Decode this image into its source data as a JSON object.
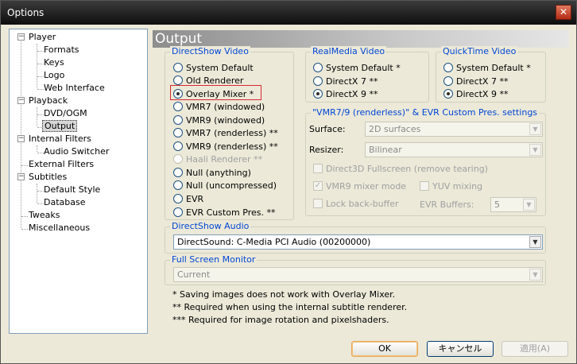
{
  "window": {
    "title": "Options",
    "close_glyph": "✕"
  },
  "tree": {
    "items": [
      {
        "label": "Player"
      },
      {
        "label": "Formats"
      },
      {
        "label": "Keys"
      },
      {
        "label": "Logo"
      },
      {
        "label": "Web Interface"
      },
      {
        "label": "Playback"
      },
      {
        "label": "DVD/OGM"
      },
      {
        "label": "Output"
      },
      {
        "label": "Internal Filters"
      },
      {
        "label": "Audio Switcher"
      },
      {
        "label": "External Filters"
      },
      {
        "label": "Subtitles"
      },
      {
        "label": "Default Style"
      },
      {
        "label": "Database"
      },
      {
        "label": "Tweaks"
      },
      {
        "label": "Miscellaneous"
      }
    ],
    "expander": "−"
  },
  "page": {
    "title": "Output"
  },
  "directshow_video": {
    "label": "DirectShow Video",
    "options": [
      "System Default",
      "Old Renderer",
      "Overlay Mixer *",
      "VMR7 (windowed)",
      "VMR9 (windowed)",
      "VMR7 (renderless) **",
      "VMR9 (renderless) **",
      "Haali Renderer **",
      "Null (anything)",
      "Null (uncompressed)",
      "EVR",
      "EVR Custom Pres. **"
    ],
    "selected": "Overlay Mixer *"
  },
  "realmedia_video": {
    "label": "RealMedia Video",
    "options": [
      "System Default *",
      "DirectX 7 **",
      "DirectX 9 **"
    ],
    "selected": "DirectX 9 **"
  },
  "quicktime_video": {
    "label": "QuickTime Video",
    "options": [
      "System Default *",
      "DirectX 7 **",
      "DirectX 9 **"
    ],
    "selected": "DirectX 9 **"
  },
  "vmr_settings": {
    "label": "\"VMR7/9 (renderless)\" & EVR Custom Pres. settings",
    "surface_label": "Surface:",
    "surface_value": "2D surfaces",
    "resizer_label": "Resizer:",
    "resizer_value": "Bilinear",
    "d3d_fullscreen": "Direct3D Fullscreen (remove tearing)",
    "vmr9_mixer": "VMR9 mixer mode",
    "yuv_mixing": "YUV mixing",
    "lock_back_buffer": "Lock back-buffer",
    "evr_buffers_label": "EVR Buffers:",
    "evr_buffers_value": "5",
    "check_glyph": "✓"
  },
  "directshow_audio": {
    "label": "DirectShow Audio",
    "value": "DirectSound: C-Media PCI Audio (00200000)"
  },
  "full_screen_monitor": {
    "label": "Full Screen Monitor",
    "value": "Current"
  },
  "notes": [
    "* Saving images does not work with Overlay Mixer.",
    "** Required when using the internal subtitle renderer.",
    "*** Required for image rotation and pixelshaders."
  ],
  "buttons": {
    "ok": "OK",
    "cancel": "キャンセル",
    "apply": "適用(A)"
  },
  "combo_arrow": "▼"
}
